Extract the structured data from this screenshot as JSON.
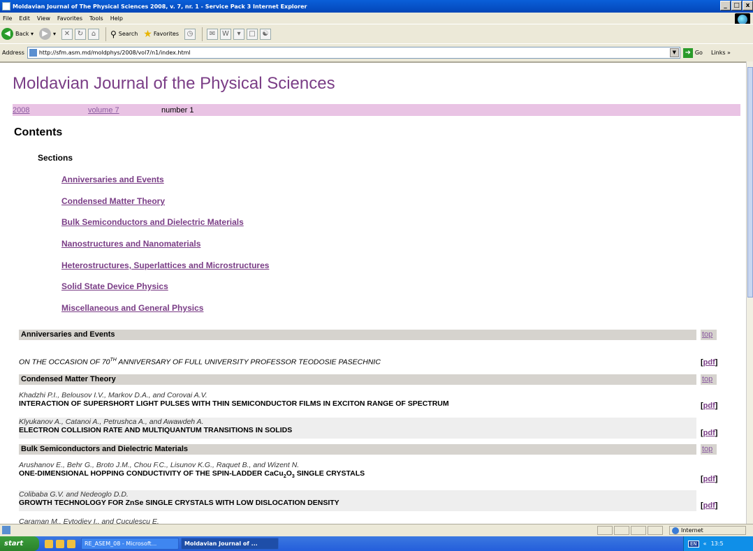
{
  "window": {
    "title": "Moldavian Journal of The Physical Sciences 2008, v. 7, nr. 1 - Service Pack 3 Internet Explorer",
    "controls": [
      "_",
      "□",
      "x"
    ]
  },
  "menu": [
    "File",
    "Edit",
    "View",
    "Favorites",
    "Tools",
    "Help"
  ],
  "toolbar": {
    "back": "Back",
    "search": "Search",
    "favorites": "Favorites"
  },
  "address": {
    "label": "Address",
    "url": "http://sfm.asm.md/moldphys/2008/vol7/n1/index.html",
    "go": "Go",
    "links": "Links"
  },
  "page": {
    "journal_title": "Moldavian Journal of the Physical Sciences",
    "year": "2008",
    "volume": "volume 7",
    "number": "number 1",
    "contents_heading": "Contents",
    "sections_heading": "Sections",
    "section_links": [
      "Anniversaries and Events",
      "Condensed Matter Theory",
      "Bulk Semiconductors and Dielectric Materials",
      "Nanostructures and Nanomaterials",
      "Heterostructures, Superlattices and Microstructures",
      "Solid State Device Physics",
      "Miscellaneous and General Physics"
    ],
    "top_label": "top",
    "pdf_label": "pdf",
    "bracket_open": "[",
    "bracket_close": "]",
    "sections": [
      {
        "name": "Anniversaries and Events",
        "articles": [
          {
            "authors": "",
            "title_prefix": "ON THE OCCASION OF 70",
            "title_sup": "TH",
            "title_suffix": " ANNIVERSARY OF FULL UNIVERSITY PROFESSOR TEODOSIE PASECHNIC"
          }
        ]
      },
      {
        "name": "Condensed Matter Theory",
        "articles": [
          {
            "authors": "Khadzhi P.I., Belousov I.V., Markov D.A., and Corovai A.V.",
            "title": "INTERACTION OF SUPERSHORT LIGHT PULSES WITH THIN SEMICONDUCTOR FILMS IN EXCITON RANGE OF SPECTRUM"
          },
          {
            "authors": "Klyukanov A., Catanoi A., Petrushca A., and Awawdeh A.",
            "title": "ELECTRON COLLISION RATE AND MULTIQUANTUM TRANSITIONS IN SOLIDS"
          }
        ]
      },
      {
        "name": "Bulk Semiconductors and Dielectric Materials",
        "articles": [
          {
            "authors": "Arushanov E., Behr G., Broto J.M., Chou F.C., Lisunov K.G., Raquet B., and Wizent N.",
            "title_prefix": "ONE-DIMENSIONAL HOPPING CONDUCTIVITY OF THE SPIN-LADDER CaCu",
            "sub1": "2",
            "title_mid": "O",
            "sub2": "3",
            "title_suffix": " SINGLE CRYSTALS"
          },
          {
            "authors": "Colibaba G.V. and Nedeoglo D.D.",
            "title": "GROWTH TECHNOLOGY FOR ZnSe SINGLE CRYSTALS WITH LOW DISLOCATION DENSITY"
          },
          {
            "authors": "Caraman M., Evtodiev I., and Cuculescu E.",
            "title": ""
          }
        ]
      }
    ]
  },
  "statusbar": {
    "zone": "Internet"
  },
  "taskbar": {
    "start": "start",
    "tasks": [
      "RE_ASEM_08 - Microsoft...",
      "Moldavian Journal of ..."
    ],
    "lang": "EN",
    "clock": "13:5"
  }
}
